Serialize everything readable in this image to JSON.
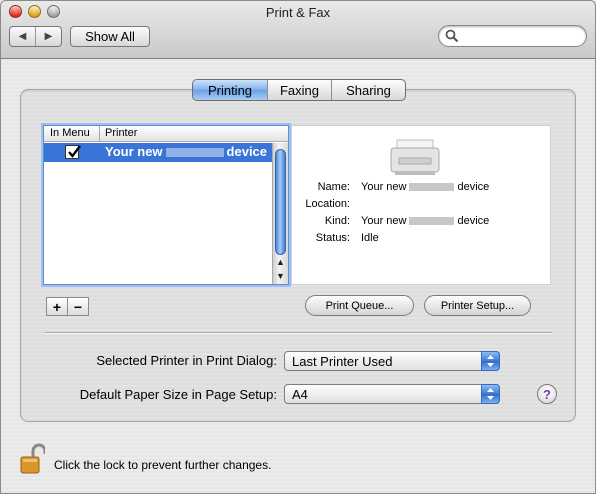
{
  "window": {
    "title": "Print & Fax"
  },
  "toolbar": {
    "show_all": "Show All",
    "search_placeholder": ""
  },
  "tabs": [
    "Printing",
    "Faxing",
    "Sharing"
  ],
  "active_tab": "Printing",
  "printer_list": {
    "headers": [
      "In Menu",
      "Printer"
    ],
    "rows": [
      {
        "in_menu": true,
        "name_prefix": "Your new",
        "name_suffix": "device"
      }
    ]
  },
  "details": {
    "name_label": "Name:",
    "name_prefix": "Your new",
    "name_suffix": "device",
    "location_label": "Location:",
    "location": "",
    "kind_label": "Kind:",
    "kind_prefix": "Your new",
    "kind_suffix": "device",
    "status_label": "Status:",
    "status": "Idle"
  },
  "list_buttons": {
    "add": "+",
    "remove": "−"
  },
  "buttons": {
    "print_queue": "Print Queue...",
    "printer_setup": "Printer Setup..."
  },
  "selected_printer": {
    "label": "Selected Printer in Print Dialog:",
    "value": "Last Printer Used"
  },
  "paper_size": {
    "label": "Default Paper Size in Page Setup:",
    "value": "A4"
  },
  "help": "?",
  "lock_text": "Click the lock to prevent further changes."
}
